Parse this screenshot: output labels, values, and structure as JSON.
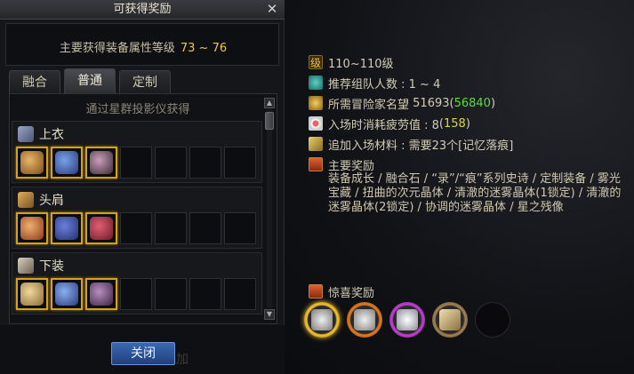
{
  "popup": {
    "title": "可获得奖励",
    "close_glyph": "✕",
    "level_label": "主要获得装备属性等级",
    "level_range": "73 ~ 76",
    "tabs": [
      {
        "label": "融合",
        "active": false
      },
      {
        "label": "普通",
        "active": true
      },
      {
        "label": "定制",
        "active": false
      }
    ],
    "list_header": "通过星群投影仪获得",
    "groups": [
      {
        "title": "上衣",
        "icon": "shirt-icon",
        "filled": 3,
        "total": 7
      },
      {
        "title": "头肩",
        "icon": "shoulder-icon",
        "filled": 3,
        "total": 7
      },
      {
        "title": "下装",
        "icon": "pants-icon",
        "filled": 3,
        "total": 7
      }
    ],
    "close_button": "关闭",
    "bg_ghost_1": "加"
  },
  "info": {
    "level_icon_text": "级",
    "level": "110~110级",
    "party_label": "推荐组队人数 : 1 ~ 4",
    "fame_label": "所需冒险家名望",
    "fame_value": "51693",
    "fame_current": "56840",
    "fatigue_label": "入场时消耗疲劳值 : 8",
    "fatigue_current": "158",
    "material_label": "追加入场材料 : 需要23个[记忆落痕]",
    "main_rewards_title": "主要奖励",
    "main_rewards_text": "装备成长 / 融合石 / “录”/“痕”系列史诗 / 定制装备 / 雾光宝藏 / 扭曲的次元晶体 / 清澈的迷雾晶体(1锁定) / 清澈的迷雾晶体(2锁定) / 协调的迷雾晶体 / 星之残像",
    "surprise_title": "惊喜奖励"
  },
  "colors": {
    "accent_gold": "#d4a21c",
    "value_green": "#5fdc3c",
    "value_yellow": "#e0d43a",
    "button_blue": "#2c559a"
  }
}
